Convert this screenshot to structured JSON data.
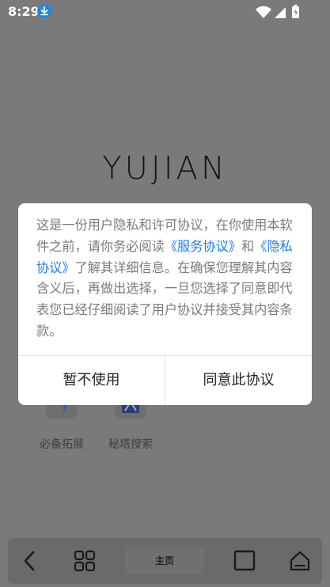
{
  "status_bar": {
    "time": "8:29",
    "icons": [
      "download-icon",
      "wifi-icon",
      "signal-icon",
      "battery-icon"
    ]
  },
  "app": {
    "logo": "YUJIAN",
    "shortcuts": [
      {
        "label": "必备拓展",
        "icon": "extension-icon"
      },
      {
        "label": "秘塔搜索",
        "icon": "search-icon"
      }
    ]
  },
  "dialog": {
    "text_before": "这是一份用户隐私和许可协议，在你使用本软件之前，请你务必阅读",
    "service_link": "《服务协议》",
    "text_and": "和",
    "privacy_link": "《隐私协议》",
    "text_after": "了解其详细信息。在确保您理解其内容含义后，再做出选择，一旦您选择了同意即代表您已经仔细阅读了用户协议并接受其内容条款。",
    "decline_label": "暂不使用",
    "agree_label": "同意此协议"
  },
  "bottom_nav": {
    "home_label": "主页",
    "items": [
      "back-icon",
      "grid-icon",
      "tabs-icon",
      "home-icon"
    ]
  },
  "colors": {
    "link": "#1e7ee8",
    "overlay": "#7a7a7a",
    "dialog_bg": "#ffffff"
  }
}
